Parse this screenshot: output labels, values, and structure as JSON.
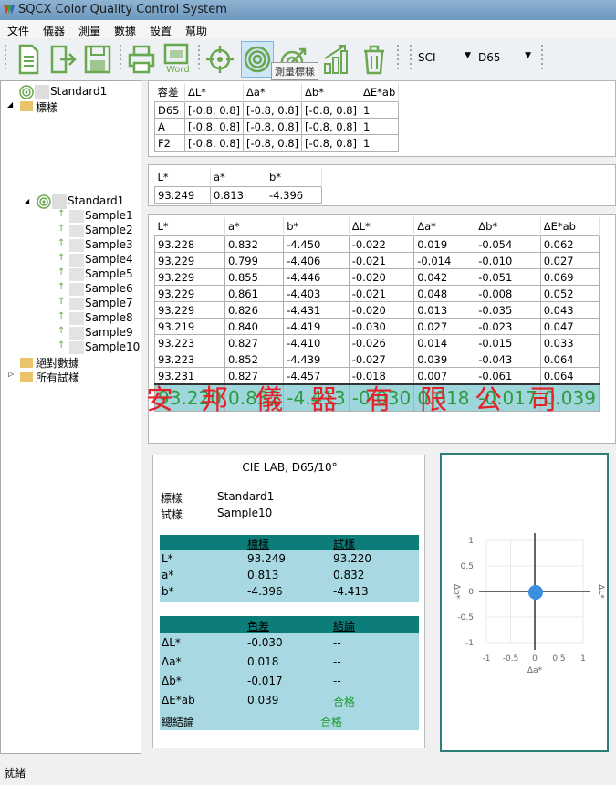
{
  "window": {
    "title": "SQCX Color Quality Control System"
  },
  "menu": [
    "文件",
    "儀器",
    "測量",
    "數據",
    "設置",
    "幫助"
  ],
  "toolbar": {
    "word_label": "Word",
    "tooltip": "測量標樣",
    "mode_select": "SCI",
    "illuminant_select": "D65"
  },
  "tree": {
    "top_standard": "Standard1",
    "standards_folder": "標樣",
    "standard": "Standard1",
    "samples": [
      "Sample1",
      "Sample2",
      "Sample3",
      "Sample4",
      "Sample5",
      "Sample6",
      "Sample7",
      "Sample8",
      "Sample9",
      "Sample10"
    ],
    "abs_folder": "絕對數據",
    "all_folder": "所有試樣"
  },
  "tolerance": {
    "headers": [
      "容差",
      "ΔL*",
      "Δa*",
      "Δb*",
      "ΔE*ab"
    ],
    "rows": [
      [
        "D65",
        "[-0.8, 0.8]",
        "[-0.8, 0.8]",
        "[-0.8, 0.8]",
        "1"
      ],
      [
        "A",
        "[-0.8, 0.8]",
        "[-0.8, 0.8]",
        "[-0.8, 0.8]",
        "1"
      ],
      [
        "F2",
        "[-0.8, 0.8]",
        "[-0.8, 0.8]",
        "[-0.8, 0.8]",
        "1"
      ]
    ]
  },
  "standard_lab": {
    "headers": [
      "L*",
      "a*",
      "b*"
    ],
    "values": [
      "93.249",
      "0.813",
      "-4.396"
    ]
  },
  "samples_table": {
    "headers": [
      "L*",
      "a*",
      "b*",
      "ΔL*",
      "Δa*",
      "Δb*",
      "ΔE*ab"
    ],
    "rows": [
      [
        "93.228",
        "0.832",
        "-4.450",
        "-0.022",
        "0.019",
        "-0.054",
        "0.062"
      ],
      [
        "93.229",
        "0.799",
        "-4.406",
        "-0.021",
        "-0.014",
        "-0.010",
        "0.027"
      ],
      [
        "93.229",
        "0.855",
        "-4.446",
        "-0.020",
        "0.042",
        "-0.051",
        "0.069"
      ],
      [
        "93.229",
        "0.861",
        "-4.403",
        "-0.021",
        "0.048",
        "-0.008",
        "0.052"
      ],
      [
        "93.229",
        "0.826",
        "-4.431",
        "-0.020",
        "0.013",
        "-0.035",
        "0.043"
      ],
      [
        "93.219",
        "0.840",
        "-4.419",
        "-0.030",
        "0.027",
        "-0.023",
        "0.047"
      ],
      [
        "93.223",
        "0.827",
        "-4.410",
        "-0.026",
        "0.014",
        "-0.015",
        "0.033"
      ],
      [
        "93.223",
        "0.852",
        "-4.439",
        "-0.027",
        "0.039",
        "-0.043",
        "0.064"
      ],
      [
        "93.231",
        "0.827",
        "-4.457",
        "-0.018",
        "0.007",
        "-0.061",
        "0.064"
      ]
    ],
    "highlight": [
      "93.220",
      "0.832",
      "-4.413",
      "-0.030",
      "0.018",
      "-0.017",
      "0.039"
    ]
  },
  "watermark": "安邦儀器有限公司",
  "report": {
    "title": "CIE LAB, D65/10°",
    "std_label": "標樣",
    "std_value": "Standard1",
    "smp_label": "試樣",
    "smp_value": "Sample10",
    "lab_headers": [
      "標樣",
      "試樣"
    ],
    "lab_rows": [
      [
        "L*",
        "93.249",
        "93.220"
      ],
      [
        "a*",
        "0.813",
        "0.832"
      ],
      [
        "b*",
        "-4.396",
        "-4.413"
      ]
    ],
    "diff_headers": [
      "色差",
      "結論"
    ],
    "diff_rows": [
      [
        "ΔL*",
        "-0.030",
        "--"
      ],
      [
        "Δa*",
        "0.018",
        "--"
      ],
      [
        "Δb*",
        "-0.017",
        "--"
      ],
      [
        "ΔE*ab",
        "0.039",
        "合格"
      ]
    ],
    "overall_label": "總結論",
    "overall_value": "合格",
    "pass_color": "#1f9a2b"
  },
  "chart_data": {
    "type": "scatter",
    "x": [
      0.018
    ],
    "y": [
      -0.017
    ],
    "xlabel": "Δa*",
    "ylabel_left": "Δb*",
    "ylabel_right": "ΔL*",
    "xlim": [
      -1,
      1
    ],
    "ylim": [
      -1,
      1
    ],
    "x_ticks": [
      "-1",
      "-0.5",
      "0",
      "0.5",
      "1"
    ],
    "y_ticks": [
      "1",
      "0.5",
      "0",
      "-0.5",
      "-1"
    ],
    "point_color": "#3b8fe0"
  },
  "status": {
    "text": "就緒"
  }
}
